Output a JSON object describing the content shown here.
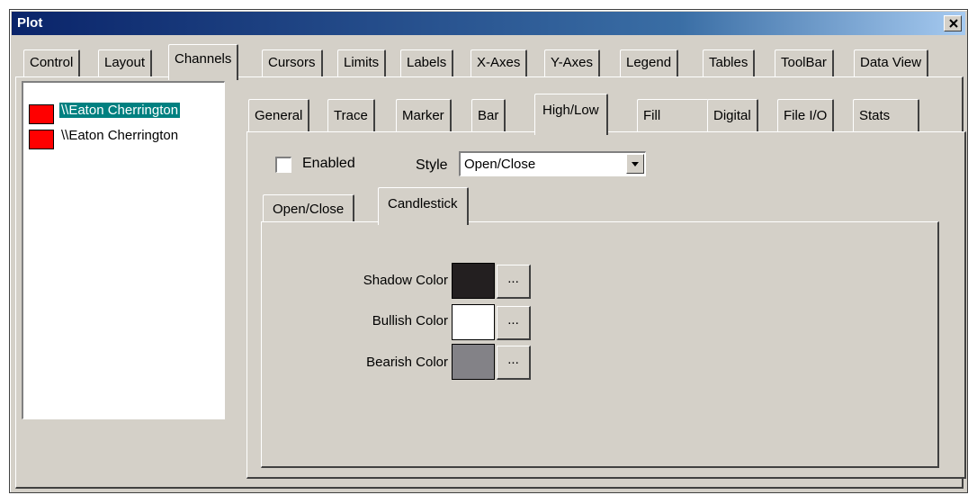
{
  "window": {
    "title": "Plot"
  },
  "main_tabs": [
    "Control",
    "Layout",
    "Channels",
    "Cursors",
    "Limits",
    "Labels",
    "X-Axes",
    "Y-Axes",
    "Legend",
    "Tables",
    "ToolBar",
    "Data View"
  ],
  "main_tabs_selected": "Channels",
  "channels": [
    {
      "label": "\\\\Eaton Cherrington",
      "color": "#ff0000",
      "selected": true
    },
    {
      "label": "\\\\Eaton Cherrington",
      "color": "#ff0000",
      "selected": false
    }
  ],
  "channel_tabs": [
    "General",
    "Trace",
    "Marker",
    "Bar",
    "High/Low",
    "Fill",
    "Digital",
    "File I/O",
    "Stats"
  ],
  "channel_tabs_selected": "High/Low",
  "highlow": {
    "enabled_label": "Enabled",
    "enabled_checked": false,
    "style_label": "Style",
    "style_value": "Open/Close"
  },
  "sub_tabs": [
    "Open/Close",
    "Candlestick"
  ],
  "sub_tabs_selected": "Candlestick",
  "candlestick": {
    "shadow_label": "Shadow Color",
    "shadow_color": "#231f20",
    "bullish_label": "Bullish Color",
    "bullish_color": "#ffffff",
    "bearish_label": "Bearish Color",
    "bearish_color": "#838287",
    "picker_label": "..."
  }
}
